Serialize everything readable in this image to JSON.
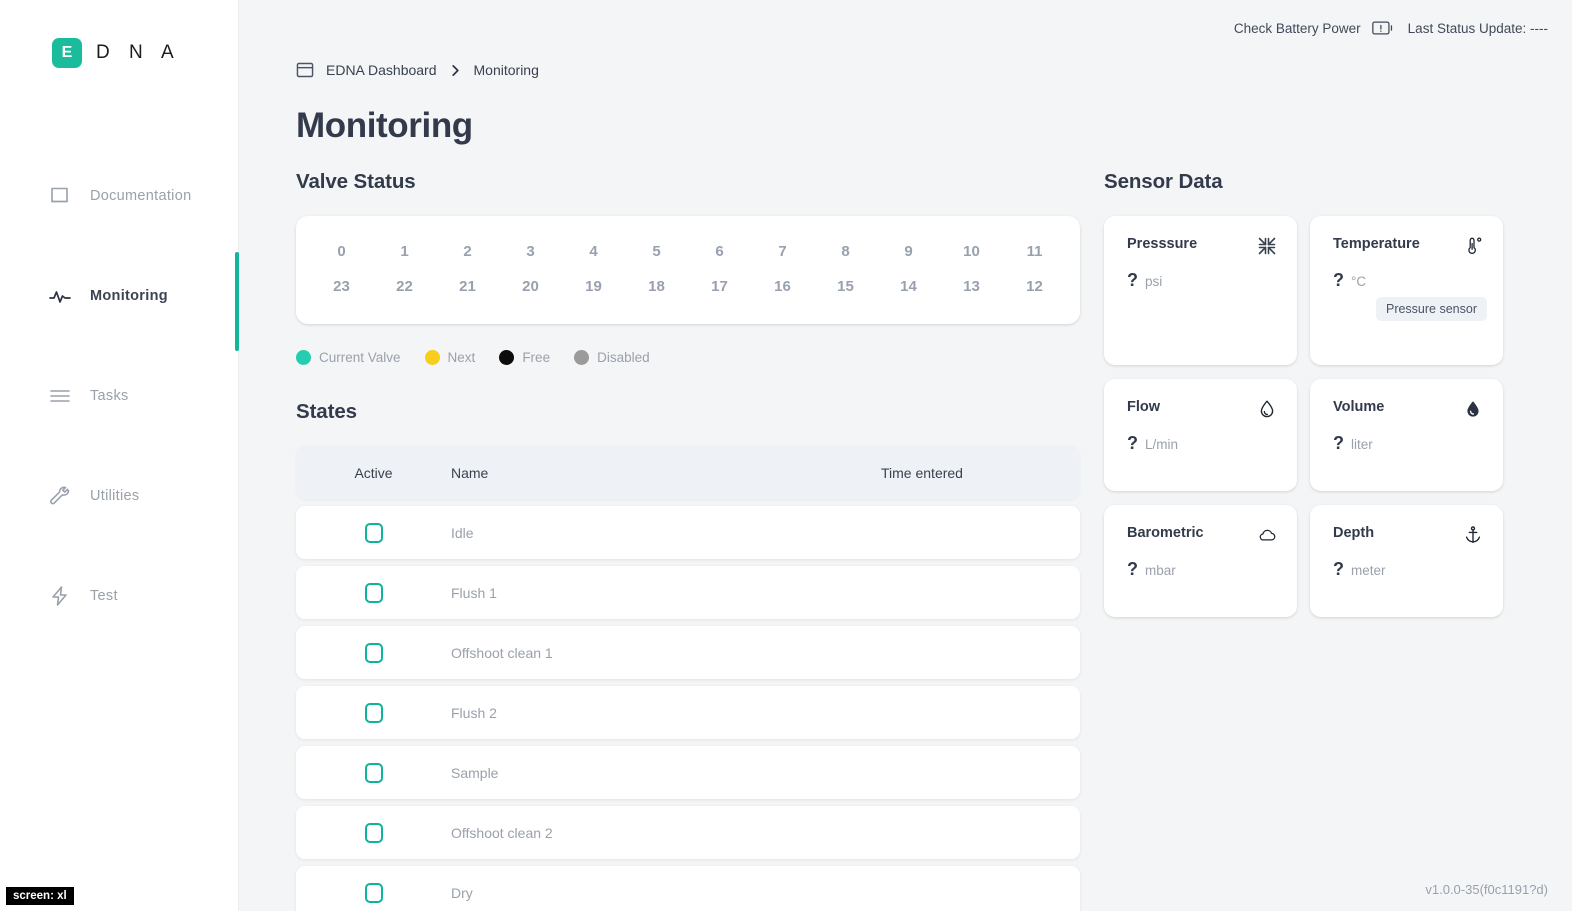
{
  "brand": {
    "badge_letter": "E",
    "letters": "D N A",
    "accent_color": "#1abc9c"
  },
  "sidebar": {
    "items": [
      {
        "label": "Documentation",
        "icon": "book-icon",
        "active": false
      },
      {
        "label": "Monitoring",
        "icon": "activity-icon",
        "active": true
      },
      {
        "label": "Tasks",
        "icon": "list-icon",
        "active": false
      },
      {
        "label": "Utilities",
        "icon": "wrench-icon",
        "active": false
      },
      {
        "label": "Test",
        "icon": "lightning-icon",
        "active": false
      }
    ]
  },
  "topbar": {
    "battery_label": "Check Battery Power",
    "battery_icon": "battery-warning-icon",
    "last_status_label": "Last Status Update:",
    "last_status_value": "----"
  },
  "breadcrumb": {
    "icon": "window-icon",
    "root": "EDNA Dashboard",
    "separator_icon": "chevron-right-icon",
    "current": "Monitoring"
  },
  "page": {
    "title": "Monitoring"
  },
  "valve_status": {
    "title": "Valve Status",
    "rows": [
      [
        "0",
        "1",
        "2",
        "3",
        "4",
        "5",
        "6",
        "7",
        "8",
        "9",
        "10",
        "11"
      ],
      [
        "23",
        "22",
        "21",
        "20",
        "19",
        "18",
        "17",
        "16",
        "15",
        "14",
        "13",
        "12"
      ]
    ],
    "legend": [
      {
        "label": "Current Valve",
        "color": "#25cdb0"
      },
      {
        "label": "Next",
        "color": "#f9cd1b"
      },
      {
        "label": "Free",
        "color": "#0c0c0c"
      },
      {
        "label": "Disabled",
        "color": "#9b9b9b"
      }
    ]
  },
  "states": {
    "title": "States",
    "columns": [
      "Active",
      "Name",
      "Time entered"
    ],
    "rows": [
      {
        "active": false,
        "name": "Idle",
        "time": ""
      },
      {
        "active": false,
        "name": "Flush 1",
        "time": ""
      },
      {
        "active": false,
        "name": "Offshoot clean 1",
        "time": ""
      },
      {
        "active": false,
        "name": "Flush 2",
        "time": ""
      },
      {
        "active": false,
        "name": "Sample",
        "time": ""
      },
      {
        "active": false,
        "name": "Offshoot clean 2",
        "time": ""
      },
      {
        "active": false,
        "name": "Dry",
        "time": ""
      }
    ]
  },
  "sensor_data": {
    "title": "Sensor Data",
    "cards": [
      {
        "name": "Presssure",
        "value": "?",
        "unit": "psi",
        "icon": "compress-arrows-icon",
        "badge": "",
        "tall": true
      },
      {
        "name": "Temperature",
        "value": "?",
        "unit": "°C",
        "icon": "thermometer-icon",
        "badge": "Pressure sensor",
        "tall": true
      },
      {
        "name": "Flow",
        "value": "?",
        "unit": "L/min",
        "icon": "water-drop-outline-icon",
        "badge": "",
        "tall": false
      },
      {
        "name": "Volume",
        "value": "?",
        "unit": "liter",
        "icon": "water-drop-filled-icon",
        "badge": "",
        "tall": false
      },
      {
        "name": "Barometric",
        "value": "?",
        "unit": "mbar",
        "icon": "cloud-icon",
        "badge": "",
        "tall": false
      },
      {
        "name": "Depth",
        "value": "?",
        "unit": "meter",
        "icon": "anchor-icon",
        "badge": "",
        "tall": false
      }
    ]
  },
  "footer": {
    "version": "v1.0.0-35(f0c1191?d)",
    "screen_badge": "screen: xl"
  }
}
